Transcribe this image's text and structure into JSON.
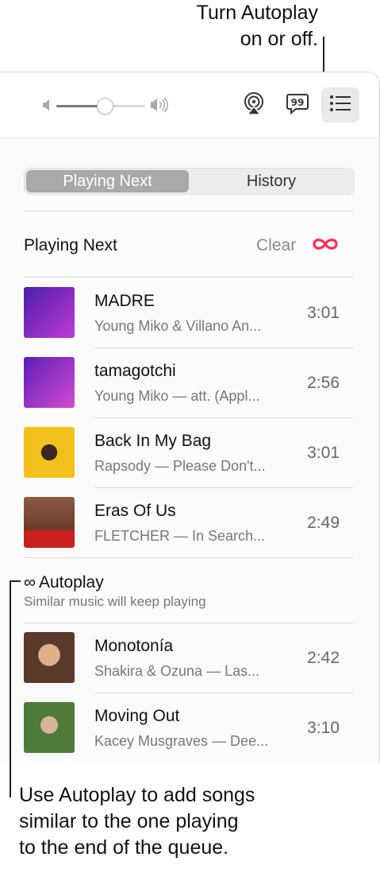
{
  "callouts": {
    "top_line1": "Turn Autoplay",
    "top_line2": "on or off.",
    "bottom_line1": "Use Autoplay to add songs",
    "bottom_line2": "similar to the one playing",
    "bottom_line3": "to the end of the queue."
  },
  "toolbar": {
    "volume_level": 0.55,
    "icons": [
      "volume-low-icon",
      "volume-high-icon",
      "airplay-icon",
      "lyrics-icon",
      "queue-list-icon"
    ]
  },
  "tabs": {
    "playing_next": "Playing Next",
    "history": "History",
    "selected": "Playing Next"
  },
  "queue": {
    "title": "Playing Next",
    "clear_label": "Clear",
    "items": [
      {
        "title": "MADRE",
        "subtitle": "Young Miko & Villano An...",
        "duration": "3:01",
        "art_colors": [
          "#4b1fa8",
          "#c03ad8"
        ]
      },
      {
        "title": "tamagotchi",
        "subtitle": "Young Miko — att. (Appl...",
        "duration": "2:56",
        "art_colors": [
          "#5a1fb8",
          "#d44ad0"
        ]
      },
      {
        "title": "Back In My Bag",
        "subtitle": "Rapsody — Please Don't...",
        "duration": "3:01",
        "art_colors": [
          "#f2c21a",
          "#3a2a22"
        ]
      },
      {
        "title": "Eras Of Us",
        "subtitle": "FLETCHER — In Search...",
        "duration": "2:49",
        "art_colors": [
          "#8a5a44",
          "#c8201e"
        ]
      }
    ]
  },
  "autoplay": {
    "symbol": "∞",
    "title": "Autoplay",
    "subtitle": "Similar music will keep playing",
    "enabled": true,
    "accent_color": "#ff2d55",
    "items": [
      {
        "title": "Monotonía",
        "subtitle": "Shakira & Ozuna — Las...",
        "duration": "2:42",
        "art_colors": [
          "#b9876a",
          "#5a3a2a"
        ]
      },
      {
        "title": "Moving Out",
        "subtitle": "Kacey Musgraves — Dee...",
        "duration": "3:10",
        "art_colors": [
          "#4f7a3a",
          "#d9e2c8"
        ]
      }
    ]
  }
}
